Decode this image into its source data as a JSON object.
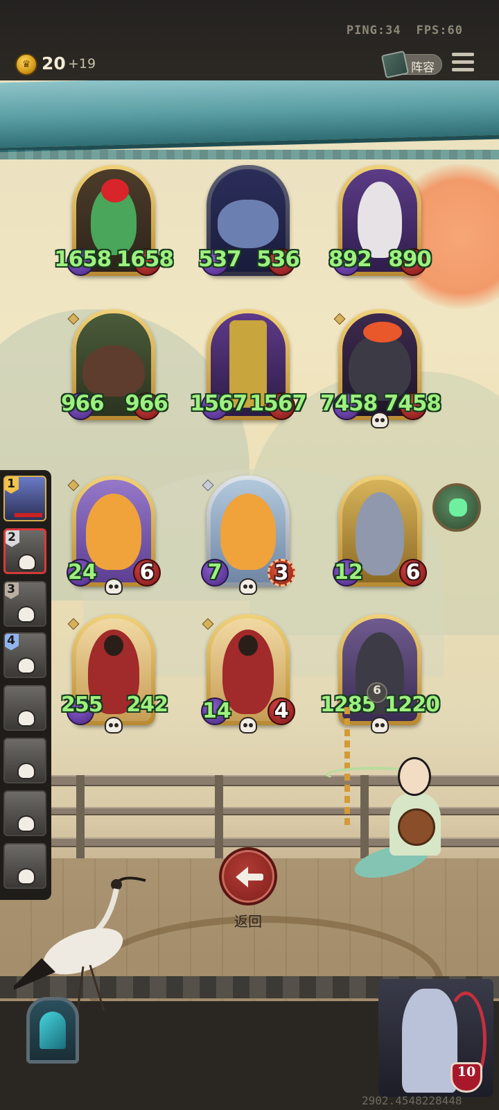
{
  "status": {
    "ping": "PING:34",
    "fps": "FPS:60"
  },
  "currency": {
    "coins": "20",
    "income": "+19"
  },
  "header": {
    "lineup_label": "阵容"
  },
  "board": {
    "enemy_units": [
      {
        "name": "frog",
        "attack": "1658",
        "health": "1658"
      },
      {
        "name": "whale",
        "attack": "537",
        "health": "536"
      },
      {
        "name": "mouse",
        "attack": "892",
        "health": "890"
      },
      {
        "name": "boar",
        "attack": "966",
        "health": "966"
      },
      {
        "name": "totem",
        "attack": "1567",
        "health": "1567"
      },
      {
        "name": "bull",
        "attack": "7458",
        "health": "7458"
      }
    ],
    "player_units": [
      {
        "name": "pelican",
        "attack": "24",
        "health": "6"
      },
      {
        "name": "pelican-silver",
        "attack": "7",
        "health": "3"
      },
      {
        "name": "knight",
        "attack": "12",
        "health": "6"
      },
      {
        "name": "monk",
        "attack": "255",
        "health": "242"
      },
      {
        "name": "monk-2",
        "attack": "14",
        "health": "4"
      },
      {
        "name": "rogue",
        "attack": "1285",
        "health": "1220"
      }
    ],
    "chain_count": "6"
  },
  "roster": {
    "slots": [
      "1",
      "2",
      "3",
      "4"
    ]
  },
  "footer": {
    "back_label": "返回",
    "hero_health": "10",
    "id_text": "2902.4548228448"
  }
}
